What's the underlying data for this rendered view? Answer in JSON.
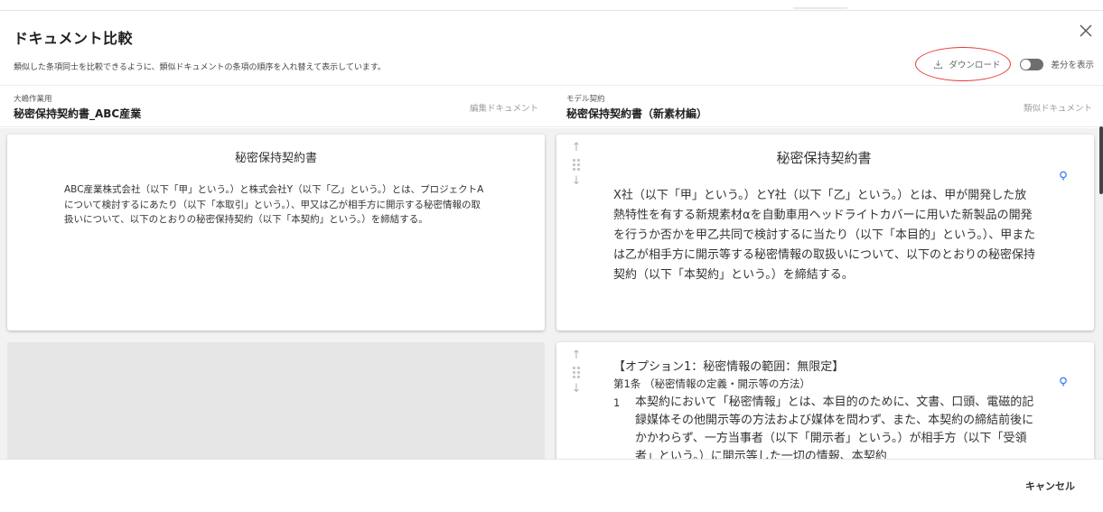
{
  "dialog": {
    "title": "ドキュメント比較",
    "description": "類似した条項同士を比較できるように、類似ドキュメントの条項の順序を入れ替えて表示しています。",
    "download_label": "ダウンロード",
    "toggle_label": "差分を表示",
    "toggle_on": false,
    "accent_ring_color": "#e53935"
  },
  "left_doc": {
    "small_label": "大嶋作業用",
    "name": "秘密保持契約書_ABC産業",
    "tag": "編集ドキュメント",
    "sections": [
      {
        "title": "秘密保持契約書",
        "body": "ABC産業株式会社（以下「甲」という。）と株式会社Y（以下「乙」という。）とは、プロジェクトAについて検討するにあたり（以下「本取引」という。）、甲又は乙が相手方に開示する秘密情報の取扱いについて、以下のとおりの秘密保持契約（以下「本契約」という。）を締結する。"
      }
    ]
  },
  "right_doc": {
    "small_label": "モデル契約",
    "name": "秘密保持契約書（新素材編）",
    "tag": "類似ドキュメント",
    "sections": [
      {
        "title": "秘密保持契約書",
        "body": "X社（以下「甲」という。）とY社（以下「乙」という。）とは、甲が開発した放熱特性を有する新規素材αを自動車用ヘッドライトカバーに用いた新製品の開発を行うか否かを甲乙共同で検討するに当たり（以下「本目的」という。）、甲または乙が相手方に開示等する秘密情報の取扱いについて、以下のとおりの秘密保持契約（以下「本契約」という。）を締結する。"
      },
      {
        "option": "【オプション1：秘密情報の範囲：無限定】",
        "article": "第1条 （秘密情報の定義・開示等の方法）",
        "num": "1",
        "body": "本契約において「秘密情報」とは、本目的のために、文書、口頭、電磁的記録媒体その他開示等の方法および媒体を問わず、また、本契約の締結前後にかかわらず、一方当事者（以下「開示者」という。）が相手方（以下「受領者」という。）に開示等した一切の情報、本契約"
      }
    ]
  },
  "icons": {
    "close": "close-icon",
    "download": "download-icon",
    "move_up": "arrow-up-icon",
    "move_down": "arrow-down-icon",
    "drag": "drag-handle-icon",
    "hint": "lightbulb-icon"
  },
  "footer": {
    "cancel_label": "キャンセル"
  }
}
